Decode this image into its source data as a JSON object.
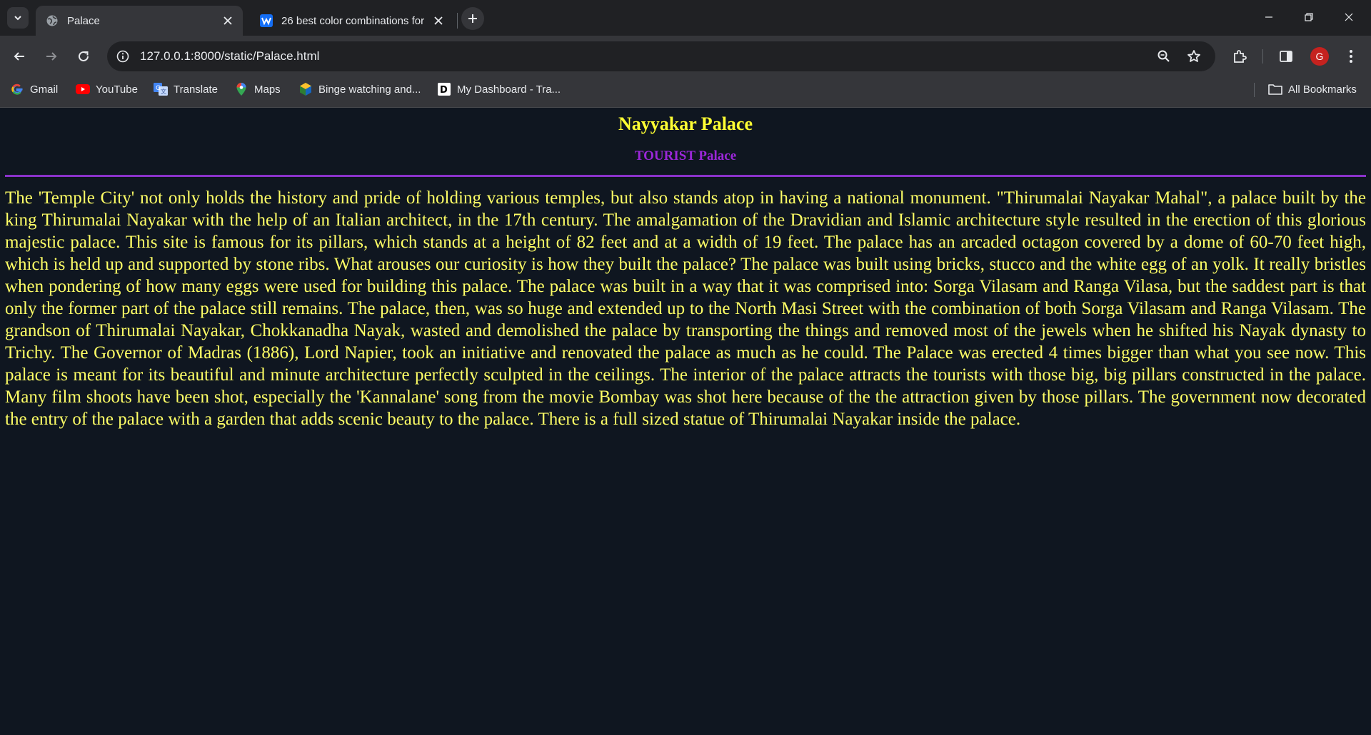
{
  "browser": {
    "tabs": [
      {
        "title": "Palace",
        "active": true,
        "icon": "globe-icon"
      },
      {
        "title": "26 best color combinations for",
        "active": false,
        "icon": "webflow-w-icon"
      }
    ],
    "url": "127.0.0.1:8000/static/Palace.html",
    "avatar_letter": "G",
    "bookmarks": [
      {
        "label": "Gmail",
        "icon": "google-g-icon"
      },
      {
        "label": "YouTube",
        "icon": "youtube-icon"
      },
      {
        "label": "Translate",
        "icon": "translate-icon"
      },
      {
        "label": "Maps",
        "icon": "maps-pin-icon"
      },
      {
        "label": "Binge watching and...",
        "icon": "binge-icon"
      },
      {
        "label": "My Dashboard - Tra...",
        "icon": "d-logo-icon"
      }
    ],
    "all_bookmarks_label": "All Bookmarks"
  },
  "page": {
    "heading": "Nayyakar Palace",
    "subheading": "TOURIST Palace",
    "body": "The 'Temple City' not only holds the history and pride of holding various temples, but also stands atop in having a national monument. \"Thirumalai Nayakar Mahal\", a palace built by the king Thirumalai Nayakar with the help of an Italian architect, in the 17th century. The amalgamation of the Dravidian and Islamic architecture style resulted in the erection of this glorious majestic palace. This site is famous for its pillars, which stands at a height of 82 feet and at a width of 19 feet. The palace has an arcaded octagon covered by a dome of 60-70 feet high, which is held up and supported by stone ribs. What arouses our curiosity is how they built the palace? The palace was built using bricks, stucco and the white egg of an yolk. It really bristles when pondering of how many eggs were used for building this palace. The palace was built in a way that it was comprised into: Sorga Vilasam and Ranga Vilasa, but the saddest part is that only the former part of the palace still remains. The palace, then, was so huge and extended up to the North Masi Street with the combination of both Sorga Vilasam and Ranga Vilasam. The grandson of Thirumalai Nayakar, Chokkanadha Nayak, wasted and demolished the palace by transporting the things and removed most of the jewels when he shifted his Nayak dynasty to Trichy. The Governor of Madras (1886), Lord Napier, took an initiative and renovated the palace as much as he could. The Palace was erected 4 times bigger than what you see now. This palace is meant for its beautiful and minute architecture perfectly sculpted in the ceilings. The interior of the palace attracts the tourists with those big, big pillars constructed in the palace. Many film shoots have been shot, especially the 'Kannalane' song from the movie Bombay was shot here because of the the attraction given by those pillars. The government now decorated the entry of the palace with a garden that adds scenic beauty to the palace. There is a full sized statue of Thirumalai Nayakar inside the palace."
  },
  "colors": {
    "page_background": "#0f1620",
    "heading": "#ffff33",
    "subheading": "#9b27d9",
    "rule": "#8a32c9",
    "body_text": "#ffff66"
  }
}
